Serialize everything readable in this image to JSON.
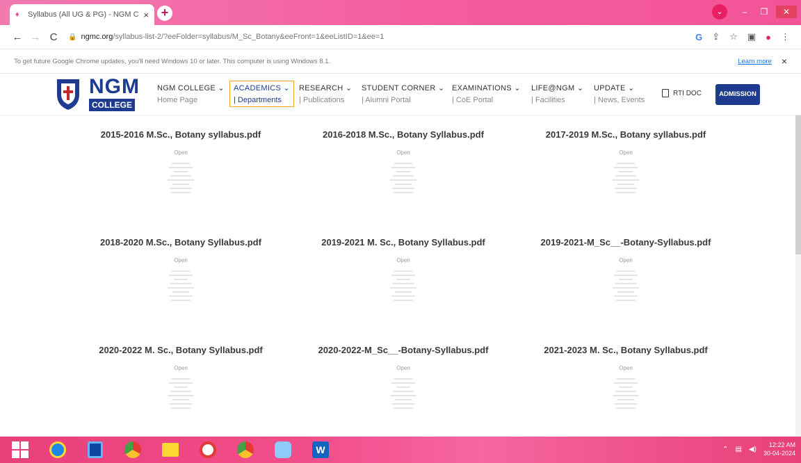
{
  "browser": {
    "tab_title": "Syllabus (All UG & PG) - NGM C",
    "tab_close": "×",
    "new_tab": "+",
    "back": "←",
    "forward": "→",
    "reload": "C",
    "url_host": "ngmc.org",
    "url_path": "/syllabus-list-2/?eeFolder=syllabus/M_Sc_Botany&eeFront=1&eeListID=1&ee=1",
    "addr_icons": [
      "G",
      "share-icon",
      "star-icon",
      "sidepanel-icon",
      "profile-icon",
      "menu-icon"
    ]
  },
  "infobar": {
    "message": "To get future Google Chrome updates, you'll need Windows 10 or later. This computer is using Windows 8.1.",
    "learn_more": "Learn more",
    "close": "×"
  },
  "site": {
    "logo_name": "NGM",
    "logo_sub": "COLLEGE",
    "menu": [
      {
        "label": "NGM COLLEGE",
        "sub": "Home Page"
      },
      {
        "label": "ACADEMICS",
        "sub": "| Departments"
      },
      {
        "label": "RESEARCH",
        "sub": "| Publications"
      },
      {
        "label": "STUDENT CORNER",
        "sub": "| Alumni Portal"
      },
      {
        "label": "EXAMINATIONS",
        "sub": "| CoE Portal"
      },
      {
        "label": "LIFE@NGM",
        "sub": "| Facilities"
      },
      {
        "label": "UPDATE",
        "sub": "| News, Events"
      }
    ],
    "rti": "RTI DOC",
    "admission": "ADMISSION",
    "colors": {
      "primary": "#1d3c8f",
      "active_border": "#f5a623"
    }
  },
  "files": [
    {
      "name": "2015-2016 M.Sc., Botany syllabus.pdf",
      "action": "Open"
    },
    {
      "name": "2016-2018 M.Sc., Botany Syllabus.pdf",
      "action": "Open"
    },
    {
      "name": "2017-2019 M.Sc., Botany syllabus.pdf",
      "action": "Open"
    },
    {
      "name": "2018-2020 M.Sc., Botany Syllabus.pdf",
      "action": "Open"
    },
    {
      "name": "2019-2021 M. Sc., Botany Syllabus.pdf",
      "action": "Open"
    },
    {
      "name": "2019-2021-M_Sc__-Botany-Syllabus.pdf",
      "action": "Open"
    },
    {
      "name": "2020-2022 M. Sc., Botany Syllabus.pdf",
      "action": "Open"
    },
    {
      "name": "2020-2022-M_Sc__-Botany-Syllabus.pdf",
      "action": "Open"
    },
    {
      "name": "2021-2023 M. Sc., Botany Syllabus.pdf",
      "action": "Open"
    }
  ],
  "taskbar": {
    "apps": [
      "windows-start",
      "internet-explorer",
      "media-player",
      "chrome",
      "file-explorer",
      "opera",
      "chrome",
      "paint",
      "word"
    ],
    "word_letter": "W",
    "time": "12:22 AM",
    "date": "30-04-2024"
  }
}
